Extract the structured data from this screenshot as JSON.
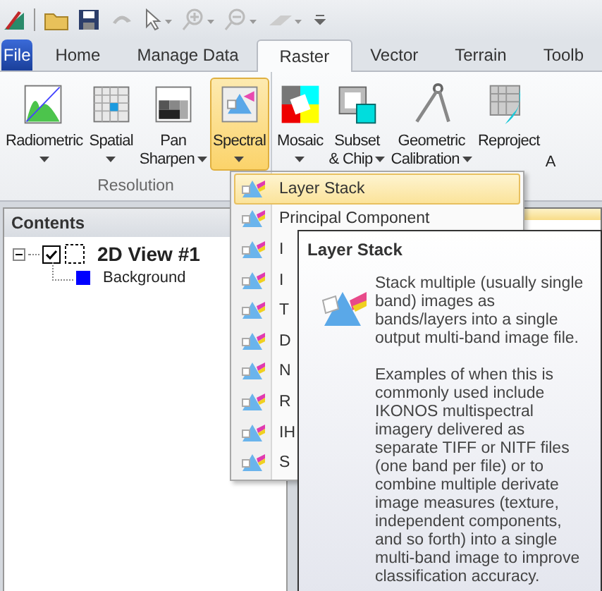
{
  "tabs": [
    {
      "label": "File",
      "kind": "file",
      "selected": false
    },
    {
      "label": "Home",
      "kind": "tab",
      "selected": false
    },
    {
      "label": "Manage Data",
      "kind": "tab",
      "selected": false
    },
    {
      "label": "Raster",
      "kind": "tab",
      "selected": true
    },
    {
      "label": "Vector",
      "kind": "tab",
      "selected": false
    },
    {
      "label": "Terrain",
      "kind": "tab",
      "selected": false
    },
    {
      "label": "Toolb",
      "kind": "tab",
      "selected": false
    }
  ],
  "ribbon": {
    "groups": [
      {
        "label": "Resolution",
        "buttons": [
          {
            "lines": [
              "Radiometric"
            ],
            "dropdown": true,
            "selected": false
          },
          {
            "lines": [
              "Spatial"
            ],
            "dropdown": true,
            "selected": false
          },
          {
            "lines": [
              "Pan",
              "Sharpen"
            ],
            "dropdown": true,
            "selected": false
          },
          {
            "lines": [
              "Spectral"
            ],
            "dropdown": true,
            "selected": true
          }
        ]
      },
      {
        "buttons": [
          {
            "lines": [
              "Mosaic"
            ],
            "dropdown": true,
            "selected": false
          },
          {
            "lines": [
              "Subset",
              "& Chip"
            ],
            "dropdown": true,
            "selected": false
          },
          {
            "lines": [
              "Geometric",
              "Calibration"
            ],
            "dropdown": true,
            "selected": false
          },
          {
            "lines": [
              "Reproject"
            ],
            "dropdown": false,
            "selected": false
          }
        ]
      }
    ],
    "cut_label": "A"
  },
  "contents": {
    "title": "Contents",
    "tree": [
      {
        "label": "2D View #1",
        "expanded": true,
        "checked": true,
        "children": [
          {
            "label": "Background",
            "color": "#0000ff"
          }
        ]
      }
    ]
  },
  "menu": {
    "items": [
      {
        "label": "Layer Stack",
        "selected": true
      },
      {
        "label": "Principal Component",
        "selected": false
      },
      {
        "label": "I",
        "selected": false
      },
      {
        "label": "I",
        "selected": false
      },
      {
        "label": "T",
        "selected": false
      },
      {
        "label": "D",
        "selected": false
      },
      {
        "label": "N",
        "selected": false
      },
      {
        "label": "R",
        "selected": false
      },
      {
        "label": "IH",
        "selected": false
      },
      {
        "label": "S",
        "selected": false
      }
    ]
  },
  "tooltip": {
    "title": "Layer Stack",
    "paragraphs": [
      "Stack multiple (usually single band) images as bands/layers into a single output multi-band image file.",
      "Examples of when this is commonly used include IKONOS multispectral imagery delivered as separate TIFF or NITF files (one band per file) or to combine multiple derivate image measures (texture, independent components, and so forth) into a single multi-band image to improve classification accuracy."
    ]
  }
}
